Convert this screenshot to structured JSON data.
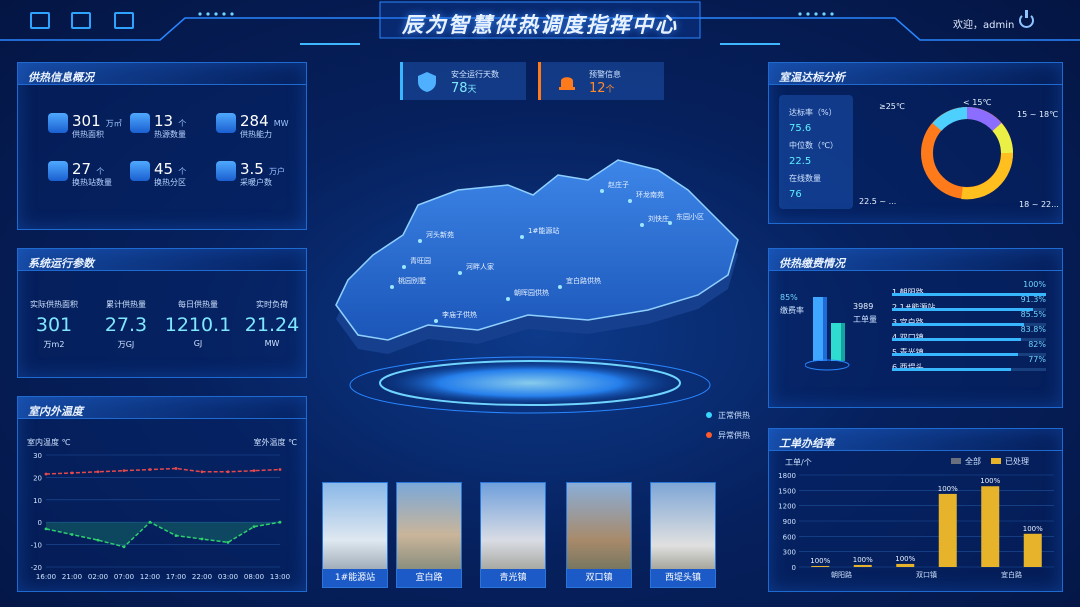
{
  "header": {
    "title": "辰为智慧供热调度指挥中心",
    "welcome": "欢迎，admin"
  },
  "supply_info": {
    "title": "供热信息概况",
    "stats": [
      {
        "value": "301",
        "unit": "万㎡",
        "label": "供热面积",
        "icon": "area-icon"
      },
      {
        "value": "13",
        "unit": "个",
        "label": "热源数量",
        "icon": "building-icon"
      },
      {
        "value": "284",
        "unit": "MW",
        "label": "供热能力",
        "icon": "house-icon"
      },
      {
        "value": "27",
        "unit": "个",
        "label": "换热站数量",
        "icon": "flame-icon"
      },
      {
        "value": "45",
        "unit": "个",
        "label": "换热分区",
        "icon": "hands-icon"
      },
      {
        "value": "3.5",
        "unit": "万户",
        "label": "采暖户数",
        "icon": "pipe-icon"
      }
    ]
  },
  "system_params": {
    "title": "系统运行参数",
    "items": [
      {
        "label": "实际供热面积",
        "value": "301",
        "unit": "万m2"
      },
      {
        "label": "累计供热量",
        "value": "27.3",
        "unit": "万GJ"
      },
      {
        "label": "每日供热量",
        "value": "1210.1",
        "unit": "GJ"
      },
      {
        "label": "实时负荷",
        "value": "21.24",
        "unit": "MW"
      }
    ]
  },
  "temperature": {
    "title": "室内外温度",
    "left_label": "室内温度 ℃",
    "right_label": "室外温度 ℃"
  },
  "top_cards": {
    "safe_label": "安全运行天数",
    "safe_value": "78",
    "safe_unit": "天",
    "alarm_label": "预警信息",
    "alarm_value": "12",
    "alarm_unit": "个"
  },
  "map": {
    "places": [
      "赵庄子",
      "环龙南苑",
      "刘快庄",
      "东园小区",
      "河头新苑",
      "1#能源站",
      "青旺园",
      "河畔人家",
      "桃园别墅",
      "朝晖园供热",
      "宜白路供热",
      "李庙子供热"
    ],
    "legend_normal": "正常供热",
    "legend_abnormal": "异常供热"
  },
  "thumbs": [
    "1#能源站",
    "宜白路",
    "青光镇",
    "双口镇",
    "西堤头镇"
  ],
  "room_temp": {
    "title": "室温达标分析",
    "rate_label": "达标率（%）",
    "rate_value": "75.6",
    "median_label": "中位数（℃）",
    "median_value": "22.5",
    "online_label": "在线数量",
    "online_value": "76",
    "donut_labels": [
      "≥25℃",
      "< 15℃",
      "15 ~ 18℃",
      "18 ~ 22...",
      "22.5 ~ ..."
    ]
  },
  "fee": {
    "title": "供热缴费情况",
    "rate_pct": "85%",
    "rate_label": "缴费率",
    "orders_value": "3989",
    "orders_label": "工单量",
    "rows": [
      {
        "name": "1 朝阳路",
        "pct": "100%",
        "frac": 1.0
      },
      {
        "name": "2 1#能源站",
        "pct": "91.3%",
        "frac": 0.913
      },
      {
        "name": "3 宜白路",
        "pct": "85.5%",
        "frac": 0.855
      },
      {
        "name": "4 双口镇",
        "pct": "83.8%",
        "frac": 0.838
      },
      {
        "name": "5 青光镇",
        "pct": "82%",
        "frac": 0.82
      },
      {
        "name": "6 西堤头",
        "pct": "77%",
        "frac": 0.77
      }
    ]
  },
  "colors": {
    "accent": "#38b6ff",
    "alarm": "#ff7a1a",
    "inner": "#e5484d",
    "outer": "#2ed06e",
    "bar": "#e6b32b"
  },
  "chart_data": [
    {
      "type": "line",
      "x": [
        "16:00",
        "21:00",
        "02:00",
        "07:00",
        "12:00",
        "17:00",
        "22:00",
        "03:00",
        "08:00",
        "13:00"
      ],
      "series": [
        {
          "name": "室内温度 ℃",
          "values": [
            21.5,
            22,
            22.5,
            23,
            23.5,
            24,
            22.5,
            22.5,
            23,
            23.5
          ]
        },
        {
          "name": "室外温度 ℃",
          "values": [
            -3,
            -5.5,
            -8,
            -11,
            0,
            -6,
            -7.5,
            -9,
            -2,
            0
          ]
        }
      ],
      "ylim": [
        -20,
        30
      ],
      "yticks": [
        30,
        20,
        10,
        0,
        -10,
        -20
      ]
    },
    {
      "type": "bar",
      "title": "工单办结率",
      "ylabel": "工单/个",
      "categories": [
        "朝阳路",
        "",
        "双口镇",
        "",
        "宜白路",
        ""
      ],
      "tick_labels": [
        "朝阳路",
        "双口镇",
        "宜白路"
      ],
      "series": [
        {
          "name": "全部",
          "values": [
            20,
            40,
            60,
            1430,
            1580,
            650
          ]
        },
        {
          "name": "已处理",
          "values": [
            20,
            40,
            60,
            1430,
            1580,
            650
          ]
        }
      ],
      "data_labels": [
        "100%",
        "100%",
        "100%",
        "100%",
        "100%",
        "100%"
      ],
      "ylim": [
        0,
        1800
      ],
      "yticks": [
        1800,
        1500,
        1200,
        900,
        600,
        300,
        0
      ]
    }
  ]
}
